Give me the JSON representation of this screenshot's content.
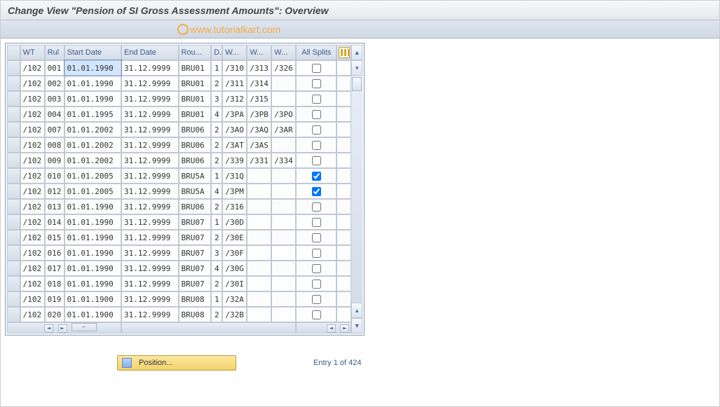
{
  "title": "Change View \"Pension of SI Gross Assessment Amounts\": Overview",
  "watermark": "www.tutorialkart.com",
  "columns": {
    "wt": "WT",
    "rul": "Rul",
    "start": "Start Date",
    "end": "End Date",
    "rou": "Rou...",
    "d": "D..",
    "w1": "W...",
    "w2": "W...",
    "w3": "W...",
    "allsplit": "All Splits"
  },
  "rows": [
    {
      "wt": "/102",
      "rul": "001",
      "start": "01.01.1990",
      "end": "31.12.9999",
      "rou": "BRU01",
      "d": "1",
      "w1": "/310",
      "w2": "/313",
      "w3": "/326",
      "split": false,
      "hl": true
    },
    {
      "wt": "/102",
      "rul": "002",
      "start": "01.01.1990",
      "end": "31.12.9999",
      "rou": "BRU01",
      "d": "2",
      "w1": "/311",
      "w2": "/314",
      "w3": "",
      "split": false
    },
    {
      "wt": "/102",
      "rul": "003",
      "start": "01.01.1990",
      "end": "31.12.9999",
      "rou": "BRU01",
      "d": "3",
      "w1": "/312",
      "w2": "/315",
      "w3": "",
      "split": false
    },
    {
      "wt": "/102",
      "rul": "004",
      "start": "01.01.1995",
      "end": "31.12.9999",
      "rou": "BRU01",
      "d": "4",
      "w1": "/3PA",
      "w2": "/3PB",
      "w3": "/3PO",
      "split": false
    },
    {
      "wt": "/102",
      "rul": "007",
      "start": "01.01.2002",
      "end": "31.12.9999",
      "rou": "BRU06",
      "d": "2",
      "w1": "/3AO",
      "w2": "/3AQ",
      "w3": "/3AR",
      "split": false
    },
    {
      "wt": "/102",
      "rul": "008",
      "start": "01.01.2002",
      "end": "31.12.9999",
      "rou": "BRU06",
      "d": "2",
      "w1": "/3AT",
      "w2": "/3AS",
      "w3": "",
      "split": false
    },
    {
      "wt": "/102",
      "rul": "009",
      "start": "01.01.2002",
      "end": "31.12.9999",
      "rou": "BRU06",
      "d": "2",
      "w1": "/339",
      "w2": "/331",
      "w3": "/334",
      "split": false
    },
    {
      "wt": "/102",
      "rul": "010",
      "start": "01.01.2005",
      "end": "31.12.9999",
      "rou": "BRU5A",
      "d": "1",
      "w1": "/31Q",
      "w2": "",
      "w3": "",
      "split": true
    },
    {
      "wt": "/102",
      "rul": "012",
      "start": "01.01.2005",
      "end": "31.12.9999",
      "rou": "BRU5A",
      "d": "4",
      "w1": "/3PM",
      "w2": "",
      "w3": "",
      "split": true
    },
    {
      "wt": "/102",
      "rul": "013",
      "start": "01.01.1990",
      "end": "31.12.9999",
      "rou": "BRU06",
      "d": "2",
      "w1": "/316",
      "w2": "",
      "w3": "",
      "split": false
    },
    {
      "wt": "/102",
      "rul": "014",
      "start": "01.01.1990",
      "end": "31.12.9999",
      "rou": "BRU07",
      "d": "1",
      "w1": "/30D",
      "w2": "",
      "w3": "",
      "split": false
    },
    {
      "wt": "/102",
      "rul": "015",
      "start": "01.01.1990",
      "end": "31.12.9999",
      "rou": "BRU07",
      "d": "2",
      "w1": "/30E",
      "w2": "",
      "w3": "",
      "split": false
    },
    {
      "wt": "/102",
      "rul": "016",
      "start": "01.01.1990",
      "end": "31.12.9999",
      "rou": "BRU07",
      "d": "3",
      "w1": "/30F",
      "w2": "",
      "w3": "",
      "split": false
    },
    {
      "wt": "/102",
      "rul": "017",
      "start": "01.01.1990",
      "end": "31.12.9999",
      "rou": "BRU07",
      "d": "4",
      "w1": "/30G",
      "w2": "",
      "w3": "",
      "split": false
    },
    {
      "wt": "/102",
      "rul": "018",
      "start": "01.01.1990",
      "end": "31.12.9999",
      "rou": "BRU07",
      "d": "2",
      "w1": "/30I",
      "w2": "",
      "w3": "",
      "split": false
    },
    {
      "wt": "/102",
      "rul": "019",
      "start": "01.01.1900",
      "end": "31.12.9999",
      "rou": "BRU08",
      "d": "1",
      "w1": "/32A",
      "w2": "",
      "w3": "",
      "split": false
    },
    {
      "wt": "/102",
      "rul": "020",
      "start": "01.01.1900",
      "end": "31.12.9999",
      "rou": "BRU08",
      "d": "2",
      "w1": "/32B",
      "w2": "",
      "w3": "",
      "split": false
    }
  ],
  "footer": {
    "position_label": "Position...",
    "entry_label": "Entry 1 of 424"
  }
}
